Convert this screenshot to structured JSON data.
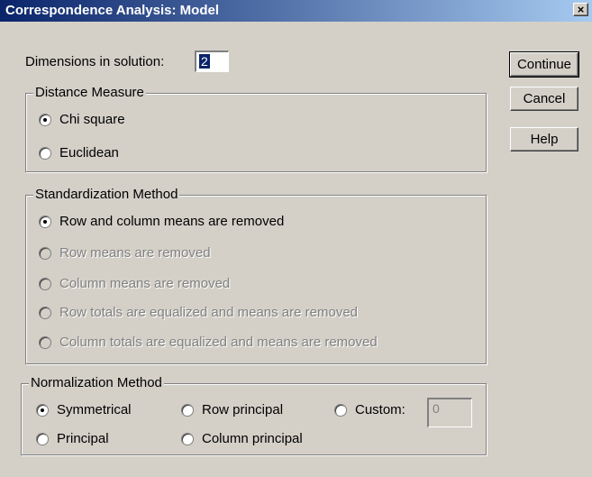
{
  "window": {
    "title": "Correspondence Analysis: Model",
    "close_glyph": "×"
  },
  "dimensions": {
    "label": "Dimensions in solution:",
    "value": "2"
  },
  "distance": {
    "legend": "Distance Measure",
    "options": [
      {
        "label": "Chi square",
        "selected": true,
        "enabled": true
      },
      {
        "label": "Euclidean",
        "selected": false,
        "enabled": true
      }
    ]
  },
  "standardization": {
    "legend": "Standardization Method",
    "options": [
      {
        "label": "Row and column means are removed",
        "selected": true,
        "enabled": true
      },
      {
        "label": "Row means are removed",
        "selected": false,
        "enabled": false
      },
      {
        "label": "Column means are removed",
        "selected": false,
        "enabled": false
      },
      {
        "label": "Row totals are equalized and means are removed",
        "selected": false,
        "enabled": false
      },
      {
        "label": "Column totals are equalized and means are removed",
        "selected": false,
        "enabled": false
      }
    ]
  },
  "normalization": {
    "legend": "Normalization Method",
    "options": [
      {
        "label": "Symmetrical",
        "selected": true,
        "enabled": true
      },
      {
        "label": "Row principal",
        "selected": false,
        "enabled": true
      },
      {
        "label": "Custom:",
        "selected": false,
        "enabled": true
      },
      {
        "label": "Principal",
        "selected": false,
        "enabled": true
      },
      {
        "label": "Column principal",
        "selected": false,
        "enabled": true
      }
    ],
    "custom_value": "0"
  },
  "buttons": {
    "continue": "Continue",
    "cancel": "Cancel",
    "help": "Help"
  }
}
